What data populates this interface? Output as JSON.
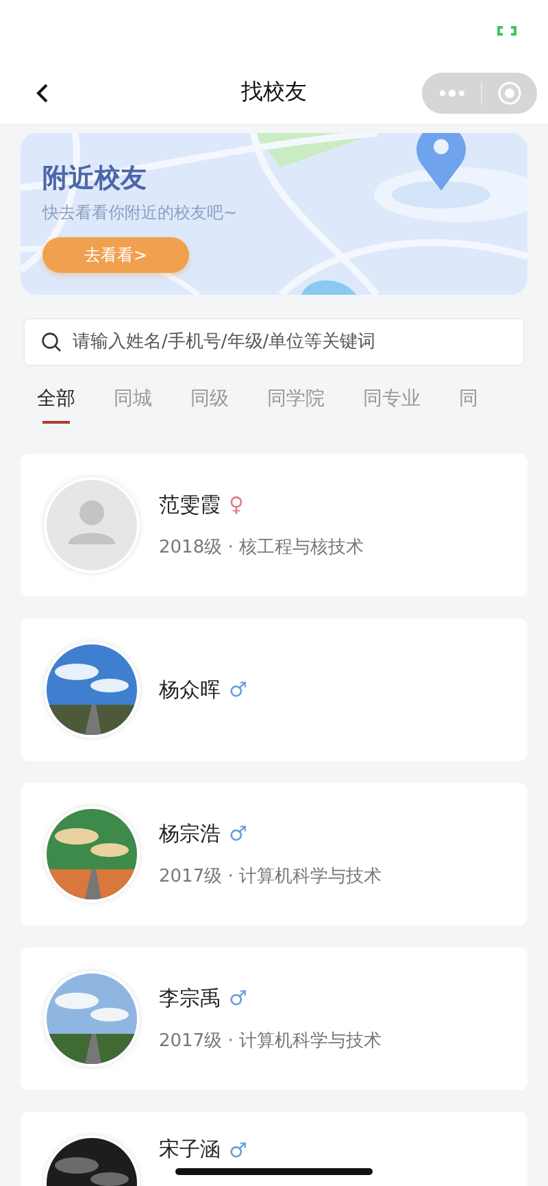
{
  "nav": {
    "title": "找校友"
  },
  "banner": {
    "title": "附近校友",
    "subtitle": "快去看看你附近的校友吧~",
    "button": "去看看>"
  },
  "search": {
    "placeholder": "请输入姓名/手机号/年级/单位等关键词"
  },
  "tabs": [
    {
      "label": "全部",
      "selected": true
    },
    {
      "label": "同城",
      "selected": false
    },
    {
      "label": "同级",
      "selected": false
    },
    {
      "label": "同学院",
      "selected": false
    },
    {
      "label": "同专业",
      "selected": false
    },
    {
      "label": "同",
      "selected": false
    }
  ],
  "people": [
    {
      "name": "范雯霞",
      "sex": {
        "symbol": "♀",
        "color": "#e07b86"
      },
      "info": "2018级 · 核工程与核技术",
      "avatar": {
        "kind": "placeholder"
      }
    },
    {
      "name": "杨众晖",
      "sex": {
        "symbol": "♂",
        "color": "#6a9fd8"
      }
    },
    {
      "name": "杨宗浩",
      "sex": {
        "symbol": "♂",
        "color": "#6a9fd8"
      },
      "info": "2017级 · 计算机科学与技术"
    },
    {
      "name": "李宗禹",
      "sex": {
        "symbol": "♂",
        "color": "#6a9fd8"
      },
      "info": "2017级 · 计算机科学与技术"
    },
    {
      "name": "宋子涵",
      "sex": {
        "symbol": "♂",
        "color": "#6a9fd8"
      }
    }
  ]
}
